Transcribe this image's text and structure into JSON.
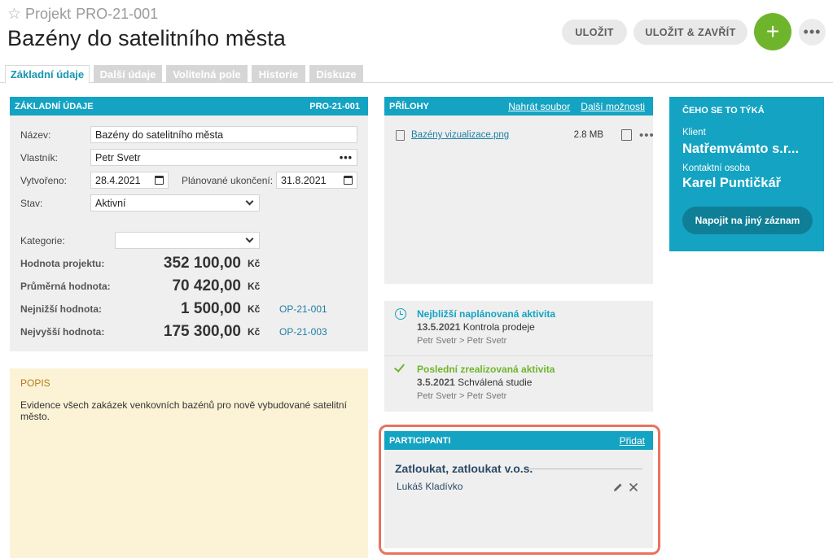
{
  "header": {
    "project_label": "Projekt",
    "project_code": "PRO-21-001",
    "title": "Bazény do satelitního města",
    "save_label": "ULOŽIT",
    "save_close_label": "ULOŽIT & ZAVŘÍT",
    "add_label": "+",
    "more_label": "•••"
  },
  "tabs": [
    "Základní údaje",
    "Další údaje",
    "Volitelná pole",
    "Historie",
    "Diskuze"
  ],
  "basic": {
    "header": "ZÁKLADNÍ ÚDAJE",
    "code": "PRO-21-001",
    "name_label": "Název:",
    "name_value": "Bazény do satelitního města",
    "owner_label": "Vlastník:",
    "owner_value": "Petr Svetr",
    "owner_more": "•••",
    "created_label": "Vytvořeno:",
    "created_value": "28.4.2021",
    "planned_end_label": "Plánované ukončení:",
    "planned_end_value": "31.8.2021",
    "state_label": "Stav:",
    "state_value": "Aktivní",
    "category_label": "Kategorie:",
    "category_value": "",
    "project_value_label": "Hodnota projektu:",
    "project_value": "352 100,00",
    "avg_label": "Průměrná hodnota:",
    "avg_value": "70 420,00",
    "min_label": "Nejnižší hodnota:",
    "min_value": "1 500,00",
    "min_ref": "OP-21-001",
    "max_label": "Nejvyšší hodnota:",
    "max_value": "175 300,00",
    "max_ref": "OP-21-003",
    "currency": "Kč"
  },
  "description": {
    "title": "POPIS",
    "text": "Evidence všech zakázek venkovních bazénů pro nově vybudované satelitní město."
  },
  "attachments": {
    "header": "PŘÍLOHY",
    "upload_label": "Nahrát soubor",
    "more_options_label": "Další možnosti",
    "files": [
      {
        "name": "Bazény vizualizace.png",
        "size": "2.8 MB"
      }
    ],
    "more": "•••"
  },
  "activities": {
    "next": {
      "title": "Nejbližší naplánovaná aktivita",
      "date": "13.5.2021",
      "subject": "Kontrola prodeje",
      "who": "Petr Svetr > Petr Svetr"
    },
    "last": {
      "title": "Poslední zrealizovaná aktivita",
      "date": "3.5.2021",
      "subject": "Schválená studie",
      "who": "Petr Svetr > Petr Svetr"
    }
  },
  "participants": {
    "header": "PARTICIPANTI",
    "add_label": "Přidat",
    "company": "Zatloukat, zatloukat v.o.s.",
    "person": "Lukáš Kladívko"
  },
  "related": {
    "title": "ČEHO SE TO TÝKÁ",
    "client_label": "Klient",
    "client_value": "Natřemvámto s.r...",
    "contact_label": "Kontaktní osoba",
    "contact_value": "Karel Puntičkář",
    "button_label": "Napojit na jiný záznam"
  },
  "colors": {
    "accent": "#14a3c2",
    "add_button": "#6fb52c",
    "highlight": "#e8735e",
    "description_bg": "#fcf3d6"
  }
}
